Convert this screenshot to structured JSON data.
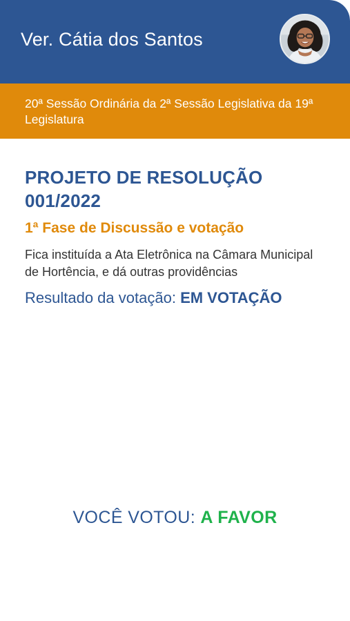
{
  "header": {
    "title": "Ver. Cátia dos Santos",
    "avatar_icon": "user-photo-avatar"
  },
  "session": {
    "text": "20ª Sessão Ordinária da 2ª Sessão Legislativa da 19ª Legislatura"
  },
  "project": {
    "title": "PROJETO DE RESOLUÇÃO 001/2022",
    "phase": "1ª Fase de Discussão e votação",
    "description": "Fica instituída a Ata Eletrônica na Câmara Municipal de Hortência, e dá outras providências",
    "result_label": "Resultado da votação:",
    "result_status": "EM VOTAÇÃO"
  },
  "vote": {
    "label": "VOCÊ VOTOU:",
    "choice": "A FAVOR"
  },
  "colors": {
    "primary": "#2d5693",
    "accent": "#e08a0b",
    "success": "#1fb24b"
  }
}
